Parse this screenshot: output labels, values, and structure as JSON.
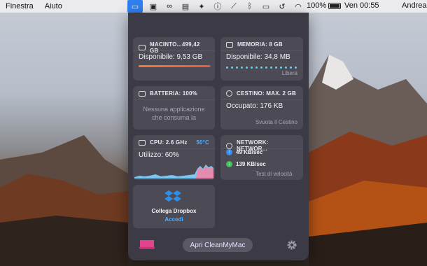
{
  "menubar": {
    "left_items": [
      "Finestra",
      "Aiuto"
    ],
    "battery_text": "100%",
    "clock": "Ven 00:55",
    "user": "Andrea"
  },
  "popover": {
    "disk": {
      "title": "MACINTO...499,42 GB",
      "value": "Disponibile: 9,53 GB",
      "used_fraction": 0.98
    },
    "memory": {
      "title": "MEMORIA: 8 GB",
      "value": "Disponibile: 34,8 MB",
      "action": "Libera"
    },
    "battery": {
      "title": "BATTERIA: 100%",
      "message": "Nessuna applicazione che consuma la"
    },
    "trash": {
      "title": "CESTINO: MAX. 2 GB",
      "value": "Occupato: 176 KB",
      "action": "Svuota il Cestino"
    },
    "cpu": {
      "title": "CPU: 2.6 GHz",
      "temp": "50°C",
      "value": "Utilizzo: 60%"
    },
    "network": {
      "title": "NETWORK: NETWOR...",
      "upload": "49 KB/sec",
      "download": "139 KB/sec",
      "action": "Test di velocità"
    },
    "dropbox": {
      "title": "Collega Dropbox",
      "action": "Accedi"
    },
    "footer": {
      "open_button": "Apri CleanMyMac"
    }
  },
  "colors": {
    "accent": "#4fb0ff",
    "upload": "#3b8df0",
    "download": "#46c05a",
    "disk_bar": "#e65a3a"
  }
}
